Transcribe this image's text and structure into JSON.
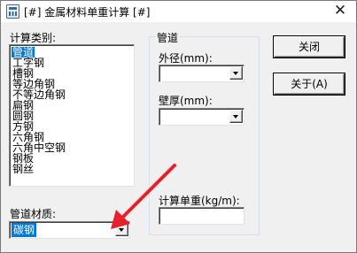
{
  "window": {
    "title": "[#] 金属材料单重计算 [#]",
    "close_glyph": "✕"
  },
  "left": {
    "category_label": "计算类别:",
    "categories": [
      "管道",
      "工字钢",
      "槽钢",
      "等边角钢",
      "不等边角钢",
      "扁钢",
      "圆钢",
      "方钢",
      "六角钢",
      "六角中空钢",
      "钢板",
      "钢丝"
    ],
    "selected_category": "管道",
    "material_label": "管道材质:",
    "material_value": "碳钢"
  },
  "group": {
    "title": "管道",
    "outer_diameter_label": "外径(mm):",
    "outer_diameter_value": "",
    "wall_thickness_label": "壁厚(mm):",
    "wall_thickness_value": "",
    "unit_weight_label": "计算单重(kg/m):",
    "unit_weight_value": ""
  },
  "buttons": {
    "close_label": "关闭",
    "about_label": "关于(A)"
  },
  "annotation": {
    "arrow_color": "#e8202a"
  }
}
